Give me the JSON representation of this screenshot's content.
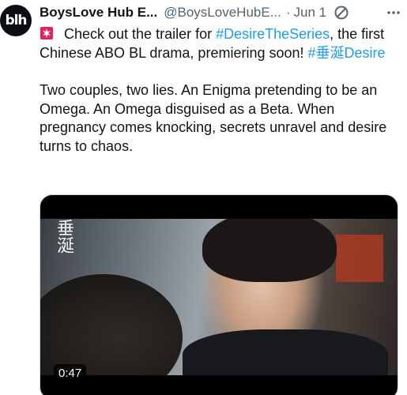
{
  "tweet": {
    "avatar_text": "blh",
    "display_name": "BoysLove Hub E...",
    "handle": "@BoysLoveHubE...",
    "separator": "·",
    "date": "Jun 1",
    "verified_icon": "verified-badge-icon",
    "more_icon": "more-horizontal-icon",
    "siren_icon": "rotating-light-icon",
    "text_part1": " Check out the trailer for ",
    "hashtag1": "#DesireTheSeries",
    "text_part2": ", the first Chinese ABO BL drama, premiering soon! ",
    "hashtag2": "#垂涎Desire",
    "paragraph2": "Two couples, two lies. An Enigma pretending to be an Omega. An Omega disguised as a Beta. When pregnancy comes knocking, secrets unravel and desire turns to chaos.",
    "video": {
      "watermark": "垂涎",
      "duration": "0:47"
    }
  },
  "colors": {
    "text": "#0f1419",
    "secondary": "#536471",
    "link": "#1d9bf0",
    "siren": "#e0245e"
  }
}
